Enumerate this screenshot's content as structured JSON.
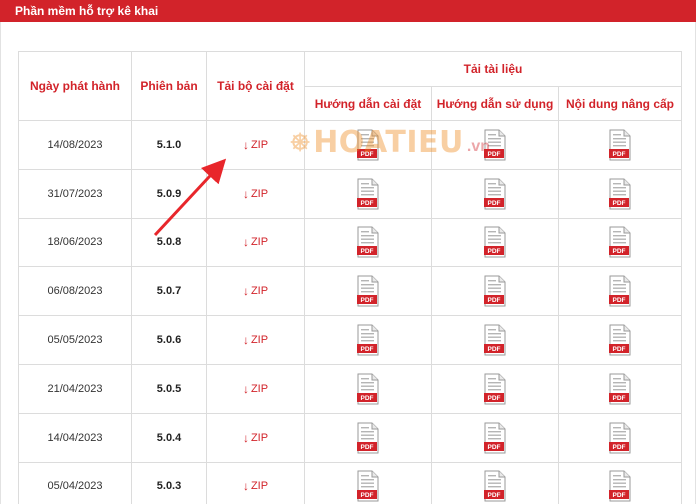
{
  "panel": {
    "title": "Phần mềm hỗ trợ kê khai"
  },
  "table": {
    "headers": {
      "release_date": "Ngày phát hành",
      "version": "Phiên bản",
      "download_installer": "Tải bộ cài đặt",
      "download_docs": "Tải tài liệu",
      "install_guide": "Hướng dẫn cài đặt",
      "user_guide": "Hướng dẫn sử dụng",
      "upgrade_notes": "Nội dung nâng cấp"
    },
    "rows": [
      {
        "date": "14/08/2023",
        "version": "5.1.0",
        "zip": "ZIP",
        "pdf": "PDF"
      },
      {
        "date": "31/07/2023",
        "version": "5.0.9",
        "zip": "ZIP",
        "pdf": "PDF"
      },
      {
        "date": "18/06/2023",
        "version": "5.0.8",
        "zip": "ZIP",
        "pdf": "PDF"
      },
      {
        "date": "06/08/2023",
        "version": "5.0.7",
        "zip": "ZIP",
        "pdf": "PDF"
      },
      {
        "date": "05/05/2023",
        "version": "5.0.6",
        "zip": "ZIP",
        "pdf": "PDF"
      },
      {
        "date": "21/04/2023",
        "version": "5.0.5",
        "zip": "ZIP",
        "pdf": "PDF"
      },
      {
        "date": "14/04/2023",
        "version": "5.0.4",
        "zip": "ZIP",
        "pdf": "PDF"
      },
      {
        "date": "05/04/2023",
        "version": "5.0.3",
        "zip": "ZIP",
        "pdf": "PDF"
      }
    ]
  },
  "watermark": {
    "brand": "HOATIEU",
    "tld": ".vn"
  },
  "colors": {
    "accent": "#d2232a",
    "logo_orange": "#f08a1c"
  },
  "icons": {
    "download": "arrow-down-icon",
    "document": "pdf-file-icon"
  }
}
